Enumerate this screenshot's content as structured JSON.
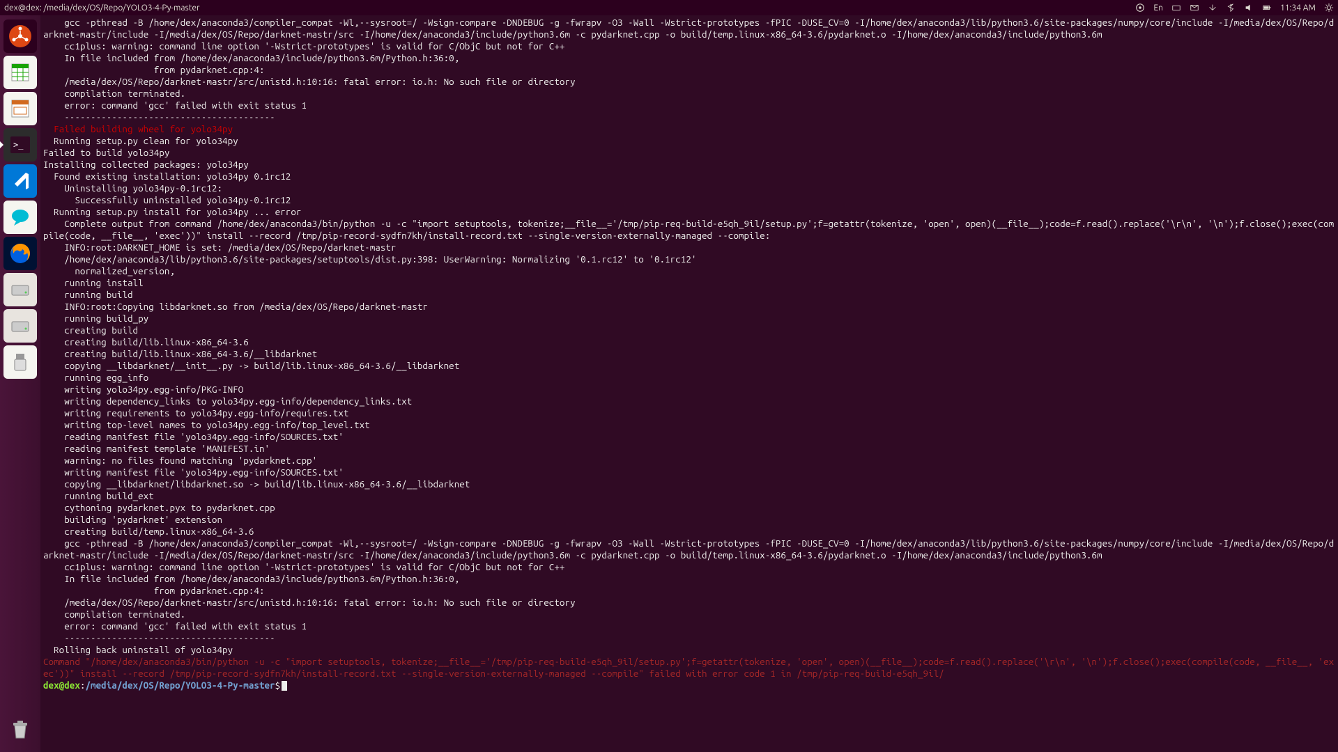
{
  "top_panel": {
    "title": "dex@dex: /media/dex/OS/Repo/YOLO3-4-Py-master",
    "lang": "En",
    "time": "11:34 AM"
  },
  "launcher": {
    "items": [
      {
        "name": "dash",
        "color": "#dd4814"
      },
      {
        "name": "libreoffice-calc",
        "color": "#18a303"
      },
      {
        "name": "libreoffice-impress",
        "color": "#d2691e"
      },
      {
        "name": "terminal",
        "color": "#2c001e",
        "active": true
      },
      {
        "name": "vscode",
        "color": "#0078d7"
      },
      {
        "name": "chat",
        "color": "#0099cc"
      },
      {
        "name": "firefox",
        "color": "#e66000"
      },
      {
        "name": "drive-1",
        "color": "#bbbbbb"
      },
      {
        "name": "drive-2",
        "color": "#bbbbbb"
      },
      {
        "name": "usb",
        "color": "#eeeeee"
      }
    ],
    "trash": "trash"
  },
  "terminal": {
    "lines": [
      {
        "t": "    gcc -pthread -B /home/dex/anaconda3/compiler_compat -Wl,--sysroot=/ -Wsign-compare -DNDEBUG -g -fwrapv -O3 -Wall -Wstrict-prototypes -fPIC -DUSE_CV=0 -I/home/dex/anaconda3/lib/python3.6/site-packages/numpy/core/include -I/media/dex/OS/Repo/darknet-mastr/include -I/media/dex/OS/Repo/darknet-mastr/src -I/home/dex/anaconda3/include/python3.6m -c pydarknet.cpp -o build/temp.linux-x86_64-3.6/pydarknet.o -I/home/dex/anaconda3/include/python3.6m"
      },
      {
        "t": "    cc1plus: warning: command line option '-Wstrict-prototypes' is valid for C/ObjC but not for C++"
      },
      {
        "t": "    In file included from /home/dex/anaconda3/include/python3.6m/Python.h:36:0,"
      },
      {
        "t": "                     from pydarknet.cpp:4:"
      },
      {
        "t": "    /media/dex/OS/Repo/darknet-mastr/src/unistd.h:10:16: fatal error: io.h: No such file or directory"
      },
      {
        "t": "    compilation terminated."
      },
      {
        "t": "    error: command 'gcc' failed with exit status 1"
      },
      {
        "t": ""
      },
      {
        "t": "    ----------------------------------------"
      },
      {
        "t": "  Failed building wheel for yolo34py",
        "c": "term-red"
      },
      {
        "t": "  Running setup.py clean for yolo34py"
      },
      {
        "t": "Failed to build yolo34py"
      },
      {
        "t": "Installing collected packages: yolo34py"
      },
      {
        "t": "  Found existing installation: yolo34py 0.1rc12"
      },
      {
        "t": "    Uninstalling yolo34py-0.1rc12:"
      },
      {
        "t": "      Successfully uninstalled yolo34py-0.1rc12"
      },
      {
        "t": "  Running setup.py install for yolo34py ... error"
      },
      {
        "t": "    Complete output from command /home/dex/anaconda3/bin/python -u -c \"import setuptools, tokenize;__file__='/tmp/pip-req-build-e5qh_9il/setup.py';f=getattr(tokenize, 'open', open)(__file__);code=f.read().replace('\\r\\n', '\\n');f.close();exec(compile(code, __file__, 'exec'))\" install --record /tmp/pip-record-sydfn7kh/install-record.txt --single-version-externally-managed --compile:"
      },
      {
        "t": "    INFO:root:DARKNET_HOME is set: /media/dex/OS/Repo/darknet-mastr"
      },
      {
        "t": "    /home/dex/anaconda3/lib/python3.6/site-packages/setuptools/dist.py:398: UserWarning: Normalizing '0.1.rc12' to '0.1rc12'"
      },
      {
        "t": "      normalized_version,"
      },
      {
        "t": "    running install"
      },
      {
        "t": "    running build"
      },
      {
        "t": "    INFO:root:Copying libdarknet.so from /media/dex/OS/Repo/darknet-mastr"
      },
      {
        "t": "    running build_py"
      },
      {
        "t": "    creating build"
      },
      {
        "t": "    creating build/lib.linux-x86_64-3.6"
      },
      {
        "t": "    creating build/lib.linux-x86_64-3.6/__libdarknet"
      },
      {
        "t": "    copying __libdarknet/__init__.py -> build/lib.linux-x86_64-3.6/__libdarknet"
      },
      {
        "t": "    running egg_info"
      },
      {
        "t": "    writing yolo34py.egg-info/PKG-INFO"
      },
      {
        "t": "    writing dependency_links to yolo34py.egg-info/dependency_links.txt"
      },
      {
        "t": "    writing requirements to yolo34py.egg-info/requires.txt"
      },
      {
        "t": "    writing top-level names to yolo34py.egg-info/top_level.txt"
      },
      {
        "t": "    reading manifest file 'yolo34py.egg-info/SOURCES.txt'"
      },
      {
        "t": "    reading manifest template 'MANIFEST.in'"
      },
      {
        "t": "    warning: no files found matching 'pydarknet.cpp'"
      },
      {
        "t": "    writing manifest file 'yolo34py.egg-info/SOURCES.txt'"
      },
      {
        "t": "    copying __libdarknet/libdarknet.so -> build/lib.linux-x86_64-3.6/__libdarknet"
      },
      {
        "t": "    running build_ext"
      },
      {
        "t": "    cythoning pydarknet.pyx to pydarknet.cpp"
      },
      {
        "t": "    building 'pydarknet' extension"
      },
      {
        "t": "    creating build/temp.linux-x86_64-3.6"
      },
      {
        "t": "    gcc -pthread -B /home/dex/anaconda3/compiler_compat -Wl,--sysroot=/ -Wsign-compare -DNDEBUG -g -fwrapv -O3 -Wall -Wstrict-prototypes -fPIC -DUSE_CV=0 -I/home/dex/anaconda3/lib/python3.6/site-packages/numpy/core/include -I/media/dex/OS/Repo/darknet-mastr/include -I/media/dex/OS/Repo/darknet-mastr/src -I/home/dex/anaconda3/include/python3.6m -c pydarknet.cpp -o build/temp.linux-x86_64-3.6/pydarknet.o -I/home/dex/anaconda3/include/python3.6m"
      },
      {
        "t": "    cc1plus: warning: command line option '-Wstrict-prototypes' is valid for C/ObjC but not for C++"
      },
      {
        "t": "    In file included from /home/dex/anaconda3/include/python3.6m/Python.h:36:0,"
      },
      {
        "t": "                     from pydarknet.cpp:4:"
      },
      {
        "t": "    /media/dex/OS/Repo/darknet-mastr/src/unistd.h:10:16: fatal error: io.h: No such file or directory"
      },
      {
        "t": "    compilation terminated."
      },
      {
        "t": "    error: command 'gcc' failed with exit status 1"
      },
      {
        "t": ""
      },
      {
        "t": "    ----------------------------------------"
      },
      {
        "t": "  Rolling back uninstall of yolo34py"
      },
      {
        "t": "Command \"/home/dex/anaconda3/bin/python -u -c \"import setuptools, tokenize;__file__='/tmp/pip-req-build-e5qh_9il/setup.py';f=getattr(tokenize, 'open', open)(__file__);code=f.read().replace('\\r\\n', '\\n');f.close();exec(compile(code, __file__, 'exec'))\" install --record /tmp/pip-record-sydfn7kh/install-record.txt --single-version-externally-managed --compile\" failed with error code 1 in /tmp/pip-req-build-e5qh_9il/",
        "c": "term-dimred"
      }
    ],
    "prompt": {
      "user": "dex@dex",
      "colon": ":",
      "path": "/media/dex/OS/Repo/YOLO3-4-Py-master",
      "dollar": "$"
    }
  }
}
